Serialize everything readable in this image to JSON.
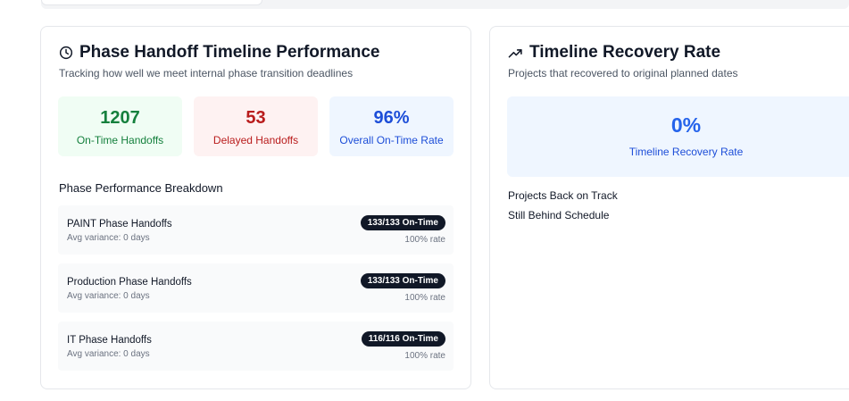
{
  "left_card": {
    "title": "Phase Handoff Timeline Performance",
    "subtitle": "Tracking how well we meet internal phase transition deadlines",
    "icon": "clock-icon",
    "stats": [
      {
        "value": "1207",
        "label": "On-Time Handoffs",
        "color": "#15803d"
      },
      {
        "value": "53",
        "label": "Delayed Handoffs",
        "color": "#b91c1c"
      },
      {
        "value": "96%",
        "label": "Overall On-Time Rate",
        "color": "#1d4ed8"
      }
    ],
    "breakdown_title": "Phase Performance Breakdown",
    "phases": [
      {
        "name": "PAINT Phase Handoffs",
        "variance": "Avg variance: 0 days",
        "badge": "133/133 On-Time",
        "rate": "100% rate"
      },
      {
        "name": "Production Phase Handoffs",
        "variance": "Avg variance: 0 days",
        "badge": "133/133 On-Time",
        "rate": "100% rate"
      },
      {
        "name": "IT Phase Handoffs",
        "variance": "Avg variance: 0 days",
        "badge": "116/116 On-Time",
        "rate": "100% rate"
      }
    ]
  },
  "right_card": {
    "title": "Timeline Recovery Rate",
    "subtitle": "Projects that recovered to original planned dates",
    "icon": "trending-up-icon",
    "recovery": {
      "value": "0%",
      "label": "Timeline Recovery Rate",
      "color": "#2563eb"
    },
    "lines": [
      "Projects Back on Track",
      "Still Behind Schedule"
    ]
  }
}
